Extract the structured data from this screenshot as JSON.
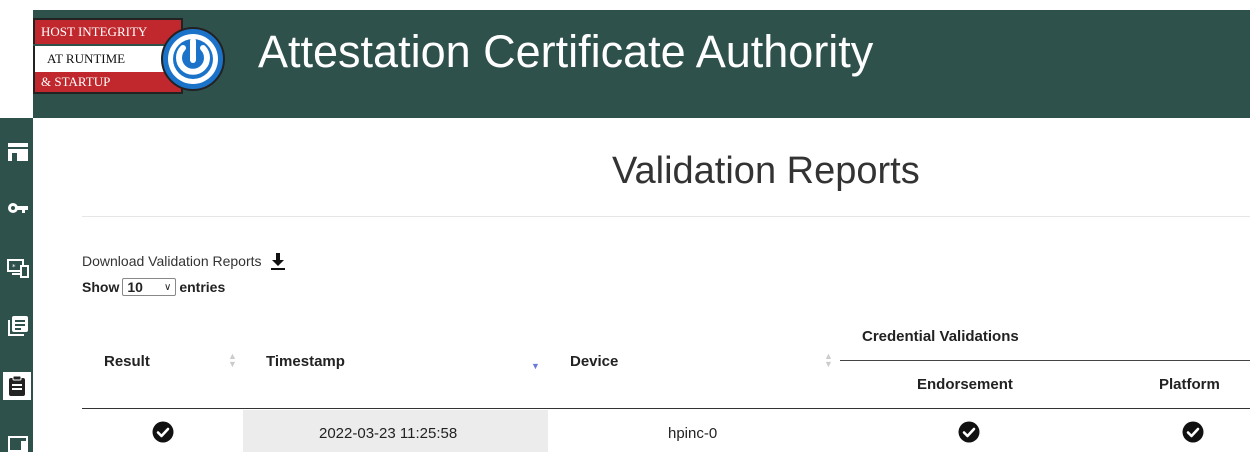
{
  "header": {
    "logo": {
      "line1": "HOST INTEGRITY",
      "line2": "AT RUNTIME",
      "line3": "& STARTUP",
      "icon": "power-icon"
    },
    "title": "Attestation Certificate Authority"
  },
  "sidebar": {
    "items": [
      {
        "icon": "storefront-icon"
      },
      {
        "icon": "key-icon"
      },
      {
        "icon": "devices-icon"
      },
      {
        "icon": "library-icon"
      },
      {
        "icon": "clipboard-icon"
      },
      {
        "icon": "laptop-icon"
      }
    ]
  },
  "page": {
    "title": "Validation Reports",
    "download_label": "Download Validation Reports",
    "show_label": "Show",
    "entries_value": "10",
    "entries_label": "entries"
  },
  "table": {
    "columns": {
      "result": "Result",
      "timestamp": "Timestamp",
      "device": "Device",
      "credential_validations": "Credential Validations",
      "endorsement": "Endorsement",
      "platform": "Platform"
    },
    "rows": [
      {
        "result": "pass",
        "timestamp": "2022-03-23 11:25:58",
        "device": "hpinc-0",
        "endorsement": "pass",
        "platform": "pass"
      }
    ]
  },
  "colors": {
    "header_bg": "#2f514c",
    "logo_red": "#c0282d",
    "logo_blue": "#1b73c9",
    "sort_active": "#6b7bd8"
  }
}
